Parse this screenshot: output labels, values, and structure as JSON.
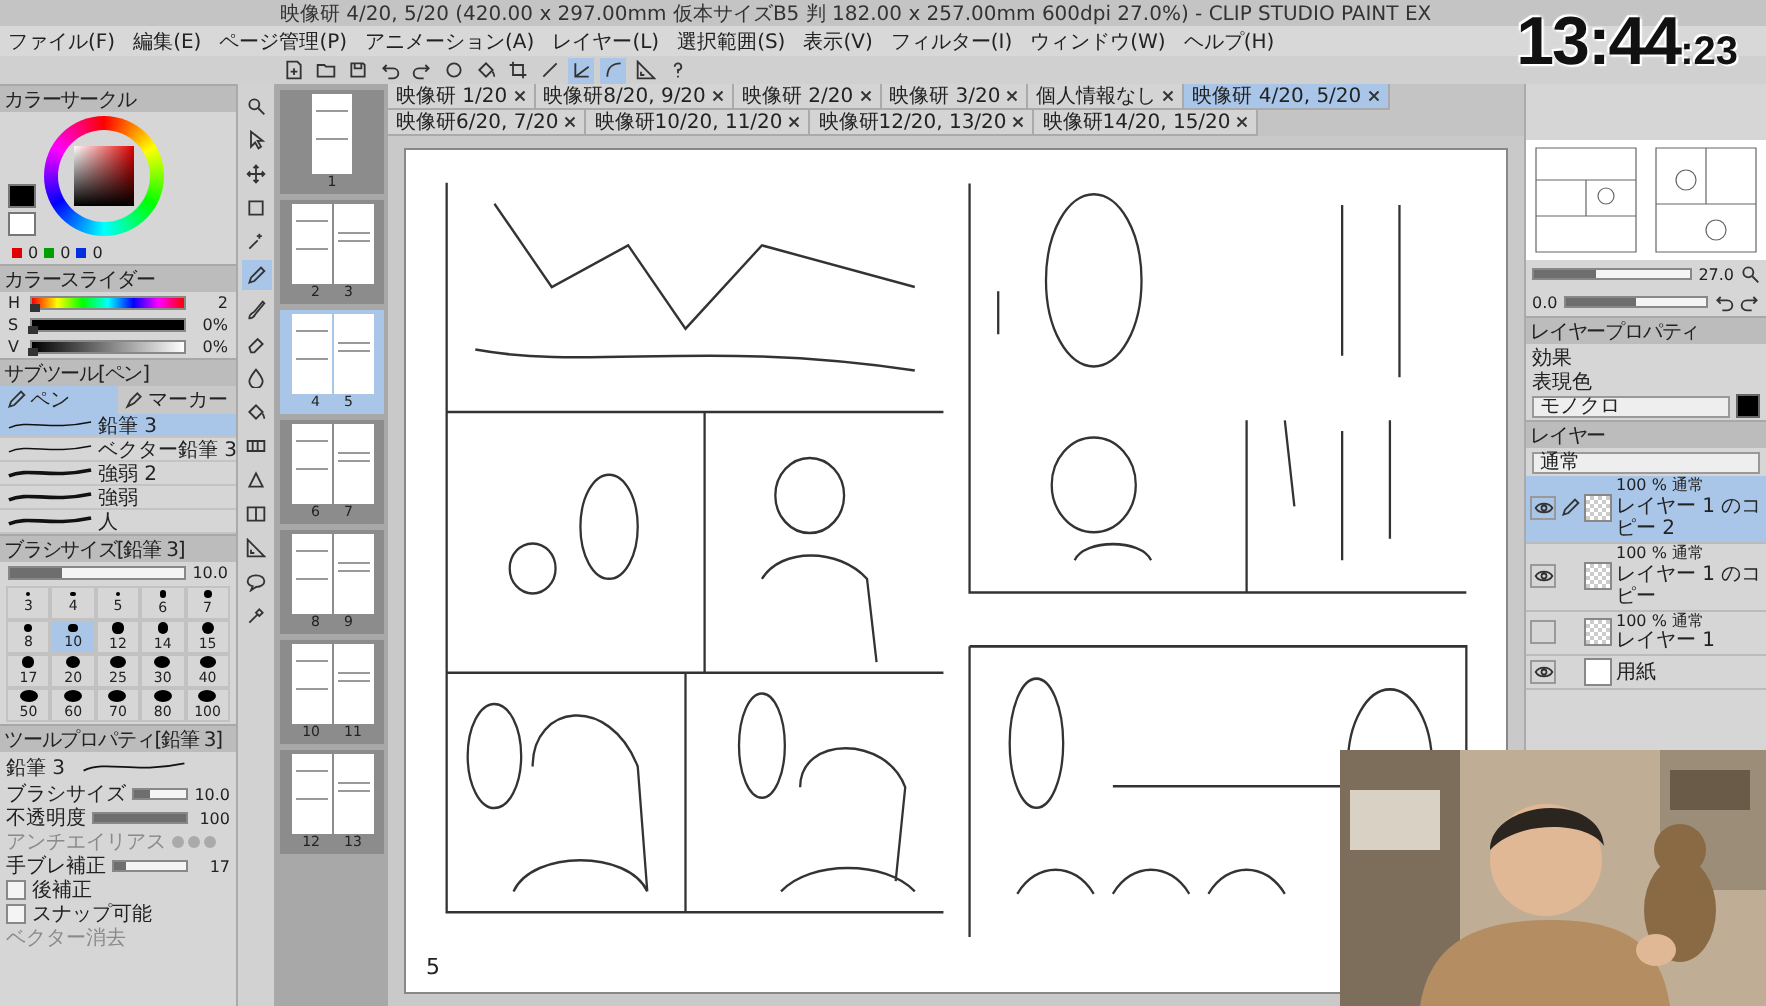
{
  "window": {
    "title": "映像研 4/20, 5/20 (420.00 x 297.00mm 仮本サイズB5 判 182.00 x 257.00mm 600dpi 27.0%) - CLIP STUDIO PAINT EX"
  },
  "clock": {
    "time": "13:44",
    "seconds": ":23"
  },
  "menu": [
    "ファイル(F)",
    "編集(E)",
    "ページ管理(P)",
    "アニメーション(A)",
    "レイヤー(L)",
    "選択範囲(S)",
    "表示(V)",
    "フィルター(I)",
    "ウィンドウ(W)",
    "ヘルプ(H)"
  ],
  "toolbar": [
    {
      "on": false
    },
    {
      "on": false
    },
    {
      "on": false
    },
    {
      "on": false
    },
    {
      "on": false
    },
    {
      "on": false
    },
    {
      "on": false
    },
    {
      "on": false
    },
    {
      "on": false
    },
    {
      "on": true
    },
    {
      "on": true
    },
    {
      "on": false
    },
    {
      "on": false
    }
  ],
  "tabs": [
    {
      "label": "映像研 1/20",
      "selected": false
    },
    {
      "label": "映像研8/20, 9/20",
      "selected": false
    },
    {
      "label": "映像研 2/20",
      "selected": false
    },
    {
      "label": "映像研 3/20",
      "selected": false
    },
    {
      "label": "個人情報なし",
      "selected": false
    },
    {
      "label": "映像研 4/20, 5/20",
      "selected": true
    },
    {
      "label": "映像研6/20, 7/20",
      "selected": false
    },
    {
      "label": "映像研10/20, 11/20",
      "selected": false
    },
    {
      "label": "映像研12/20, 13/20",
      "selected": false
    },
    {
      "label": "映像研14/20, 15/20",
      "selected": false
    }
  ],
  "color_panel": {
    "title": "カラーサークル",
    "rgb": [
      "0",
      "0",
      "0"
    ]
  },
  "color_slider": {
    "title": "カラースライダー",
    "rows": [
      {
        "label": "H",
        "level": 0.01,
        "reading": "2"
      },
      {
        "label": "S",
        "level": 0,
        "reading": "0%"
      },
      {
        "label": "V",
        "level": 0,
        "reading": "0%"
      }
    ]
  },
  "sub_tool": {
    "title": "サブツール[ペン]",
    "groups": [
      {
        "label": "ペン",
        "selected": true
      },
      {
        "label": "マーカー",
        "selected": false
      }
    ],
    "brushes": [
      {
        "label": "鉛筆 3",
        "selected": true
      },
      {
        "label": "ベクター鉛筆 3",
        "selected": false
      },
      {
        "label": "強弱 2",
        "selected": false
      },
      {
        "label": "強弱",
        "selected": false
      },
      {
        "label": "人",
        "selected": false
      }
    ]
  },
  "brush_size": {
    "title": "ブラシサイズ[鉛筆 3]",
    "level": 0.3,
    "reading": "10.0",
    "sizes": [
      {
        "label": "3",
        "selected": false
      },
      {
        "label": "4",
        "selected": false
      },
      {
        "label": "5",
        "selected": false
      },
      {
        "label": "6",
        "selected": false
      },
      {
        "label": "7",
        "selected": false
      },
      {
        "label": "8",
        "selected": false
      },
      {
        "label": "10",
        "selected": true
      },
      {
        "label": "12",
        "selected": false
      },
      {
        "label": "14",
        "selected": false
      },
      {
        "label": "15",
        "selected": false
      },
      {
        "label": "17",
        "selected": false
      },
      {
        "label": "20",
        "selected": false
      },
      {
        "label": "25",
        "selected": false
      },
      {
        "label": "30",
        "selected": false
      },
      {
        "label": "40",
        "selected": false
      },
      {
        "label": "50",
        "selected": false
      },
      {
        "label": "60",
        "selected": false
      },
      {
        "label": "70",
        "selected": false
      },
      {
        "label": "80",
        "selected": false
      },
      {
        "label": "100",
        "selected": false
      }
    ]
  },
  "tool_property": {
    "title": "ツールプロパティ[鉛筆 3]",
    "brush": "鉛筆 3",
    "rows": [
      {
        "kind": "slider",
        "label": "ブラシサイズ",
        "level": 0.3,
        "reading": "10.0"
      },
      {
        "kind": "slider",
        "label": "不透明度",
        "level": 1,
        "reading": "100"
      },
      {
        "kind": "dots",
        "label": "アンチエイリアス"
      },
      {
        "kind": "slider",
        "label": "手ブレ補正",
        "level": 0.17,
        "reading": "17"
      },
      {
        "kind": "checkbox",
        "label": "後補正",
        "checked": false
      },
      {
        "kind": "checkbox",
        "label": "スナップ可能",
        "checked": false
      },
      {
        "kind": "option",
        "label": "ベクター消去"
      }
    ]
  },
  "tools": [
    {
      "selected": false
    },
    {
      "selected": false
    },
    {
      "selected": false
    },
    {
      "selected": false
    },
    {
      "selected": false
    },
    {
      "selected": true
    },
    {
      "selected": false
    },
    {
      "selected": false
    },
    {
      "selected": false
    },
    {
      "selected": false
    },
    {
      "selected": false
    },
    {
      "selected": false
    },
    {
      "selected": false
    },
    {
      "selected": false
    },
    {
      "selected": false
    },
    {
      "selected": false
    }
  ],
  "pages": [
    {
      "numbers": [
        "1"
      ],
      "selected": false
    },
    {
      "numbers": [
        "2",
        "3"
      ],
      "selected": false
    },
    {
      "numbers": [
        "4",
        "5"
      ],
      "selected": true
    },
    {
      "numbers": [
        "6",
        "7"
      ],
      "selected": false
    },
    {
      "numbers": [
        "8",
        "9"
      ],
      "selected": false
    },
    {
      "numbers": [
        "10",
        "11"
      ],
      "selected": false
    },
    {
      "numbers": [
        "12",
        "13"
      ],
      "selected": false
    }
  ],
  "canvas": {
    "page_number": "5"
  },
  "navigator": {
    "zoom": {
      "reading": "27.0",
      "level": 0.4
    },
    "rotate": {
      "reading": "0.0",
      "level": 0.5
    }
  },
  "layer_property": {
    "title": "レイヤープロパティ",
    "effect_label": "効果",
    "color_label": "表現色",
    "color_mode": "モノクロ"
  },
  "layers_panel": {
    "title": "レイヤー",
    "blend": "通常",
    "layers": [
      {
        "kind": "raster",
        "opacity": "100 % 通常",
        "name": "レイヤー 1 のコピー 2",
        "visible": true,
        "selected": true
      },
      {
        "kind": "raster",
        "opacity": "100 % 通常",
        "name": "レイヤー 1 のコピー",
        "visible": true,
        "selected": false
      },
      {
        "kind": "raster",
        "opacity": "100 % 通常",
        "name": "レイヤー 1",
        "visible": false,
        "selected": false
      },
      {
        "kind": "paper",
        "name": "用紙",
        "visible": true,
        "selected": false
      }
    ]
  }
}
